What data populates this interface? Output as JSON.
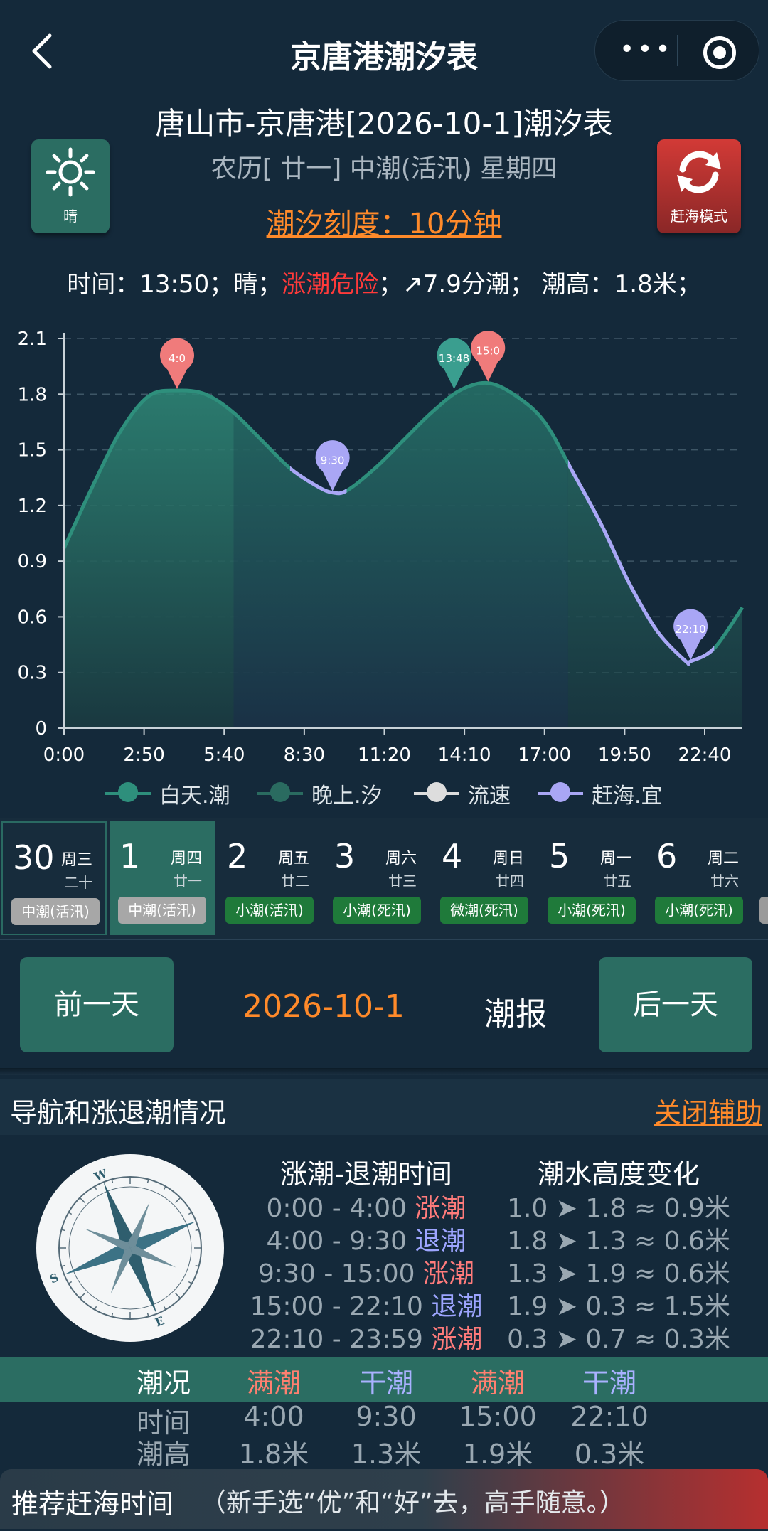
{
  "header": {
    "title": "京唐港潮汐表",
    "more_icon": "more-dots-icon",
    "target_icon": "record-target-icon"
  },
  "info": {
    "title": "唐山市-京唐港[2026-10-1]潮汐表",
    "subtitle": "农历[ 廿一] 中潮(活汛) 星期四",
    "scale": "潮汐刻度：10分钟",
    "weather_label": "晴",
    "mode_label": "赶海模式",
    "status_time": "时间：13:50；晴；",
    "status_danger": "涨潮危险",
    "status_rest": "；↗7.9分潮；  潮高：1.8米；"
  },
  "chart_data": {
    "type": "area",
    "ylim": [
      0,
      2.1
    ],
    "y_ticks": [
      "0",
      "0.3",
      "0.6",
      "0.9",
      "1.2",
      "1.5",
      "1.8",
      "2.1"
    ],
    "x_ticks": [
      "0:00",
      "2:50",
      "5:40",
      "8:30",
      "11:20",
      "14:10",
      "17:00",
      "19:50",
      "22:40"
    ],
    "x_range_minutes": [
      0,
      1440
    ],
    "points": [
      [
        0,
        0.97
      ],
      [
        60,
        1.3
      ],
      [
        120,
        1.6
      ],
      [
        180,
        1.79
      ],
      [
        240,
        1.82
      ],
      [
        300,
        1.8
      ],
      [
        360,
        1.7
      ],
      [
        420,
        1.55
      ],
      [
        480,
        1.4
      ],
      [
        540,
        1.3
      ],
      [
        570,
        1.27
      ],
      [
        600,
        1.28
      ],
      [
        660,
        1.4
      ],
      [
        720,
        1.55
      ],
      [
        780,
        1.7
      ],
      [
        840,
        1.82
      ],
      [
        900,
        1.86
      ],
      [
        960,
        1.79
      ],
      [
        1020,
        1.65
      ],
      [
        1080,
        1.38
      ],
      [
        1140,
        1.1
      ],
      [
        1200,
        0.78
      ],
      [
        1260,
        0.52
      ],
      [
        1320,
        0.36
      ],
      [
        1330,
        0.36
      ],
      [
        1380,
        0.43
      ],
      [
        1440,
        0.65
      ]
    ],
    "day_shading": [
      [
        360,
        1070
      ]
    ],
    "markers": [
      {
        "label": "4:0",
        "x": 240,
        "y": 1.82,
        "color": "#f07b7b"
      },
      {
        "label": "9:30",
        "x": 570,
        "y": 1.27,
        "color": "#a9a6f5"
      },
      {
        "label": "13:48",
        "x": 828,
        "y": 1.82,
        "color": "#3a9e8f"
      },
      {
        "label": "15:0",
        "x": 900,
        "y": 1.86,
        "color": "#f07b7b"
      },
      {
        "label": "22:10",
        "x": 1330,
        "y": 0.36,
        "color": "#a9a6f5"
      }
    ],
    "sea_windows": [
      [
        480,
        600
      ],
      [
        1070,
        1380
      ]
    ],
    "series": [
      {
        "name": "白天.潮",
        "color": "#2e8f7c"
      },
      {
        "name": "晚上.汐",
        "color": "#2a6b60"
      },
      {
        "name": "流速",
        "color": "#dddddd"
      },
      {
        "name": "赶海.宜",
        "color": "#a9a6f5"
      }
    ]
  },
  "days": [
    {
      "num": "30",
      "week": "周三",
      "lunar": "二十",
      "badge": "中潮(活汛)",
      "badge_color": "gray"
    },
    {
      "num": "1",
      "week": "周四",
      "lunar": "廿一",
      "badge": "中潮(活汛)",
      "badge_color": "gray"
    },
    {
      "num": "2",
      "week": "周五",
      "lunar": "廿二",
      "badge": "小潮(活汛)",
      "badge_color": "green"
    },
    {
      "num": "3",
      "week": "周六",
      "lunar": "廿三",
      "badge": "小潮(死汛)",
      "badge_color": "green"
    },
    {
      "num": "4",
      "week": "周日",
      "lunar": "廿四",
      "badge": "微潮(死汛)",
      "badge_color": "green"
    },
    {
      "num": "5",
      "week": "周一",
      "lunar": "廿五",
      "badge": "小潮(死汛)",
      "badge_color": "green"
    },
    {
      "num": "6",
      "week": "周二",
      "lunar": "廿六",
      "badge": "小潮(死汛)",
      "badge_color": "green"
    }
  ],
  "nav": {
    "prev": "前一天",
    "date": "2026-10-1",
    "report": "潮报",
    "next": "后一天"
  },
  "section": {
    "title": "导航和涨退潮情况",
    "close": "关闭辅助"
  },
  "compass": {
    "icon": "compass-icon"
  },
  "tide_times": {
    "header": "涨潮-退潮时间",
    "rows": [
      {
        "range": "0:00 - 4:00",
        "state": "涨潮",
        "type": "rise"
      },
      {
        "range": "4:00 - 9:30",
        "state": "退潮",
        "type": "fall"
      },
      {
        "range": "9:30 - 15:00",
        "state": "涨潮",
        "type": "rise"
      },
      {
        "range": "15:00 - 22:10",
        "state": "退潮",
        "type": "fall"
      },
      {
        "range": "22:10 - 23:59",
        "state": "涨潮",
        "type": "rise"
      }
    ]
  },
  "height_change": {
    "header": "潮水高度变化",
    "rows": [
      "1.0 ➤ 1.8 ≈ 0.9米",
      "1.8 ➤ 1.3 ≈ 0.6米",
      "1.3 ➤ 1.9 ≈ 0.6米",
      "1.9 ➤ 0.3 ≈ 1.5米",
      "0.3 ➤ 0.7 ≈ 0.3米"
    ]
  },
  "summary": {
    "labels": {
      "state": "潮况",
      "time": "时间",
      "height": "潮高"
    },
    "cols": [
      {
        "state": "满潮",
        "time": "4:00",
        "height": "1.8米",
        "type": "hi"
      },
      {
        "state": "干潮",
        "time": "9:30",
        "height": "1.3米",
        "type": "lo"
      },
      {
        "state": "满潮",
        "time": "15:00",
        "height": "1.9米",
        "type": "hi"
      },
      {
        "state": "干潮",
        "time": "22:10",
        "height": "0.3米",
        "type": "lo"
      }
    ]
  },
  "recommend": {
    "title": "推荐赶海时间",
    "note": "（新手选“优”和“好”去，高手随意。）"
  }
}
